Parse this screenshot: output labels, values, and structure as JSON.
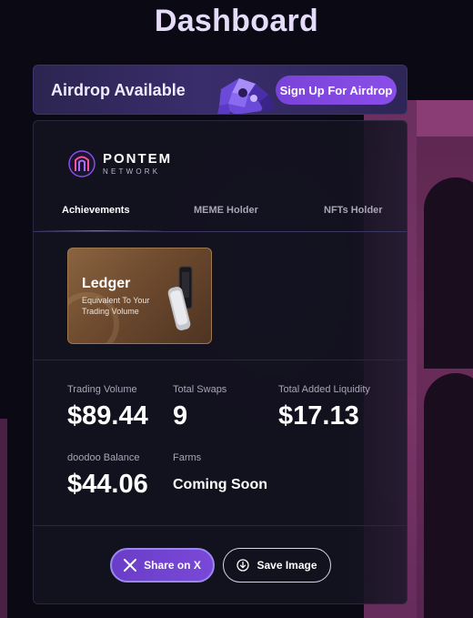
{
  "page": {
    "title": "Dashboard"
  },
  "airdrop": {
    "label": "Airdrop Available",
    "button_label": "Sign Up For Airdrop"
  },
  "brand": {
    "name": "PONTEM",
    "sub": "NETWORK"
  },
  "tabs": [
    {
      "label": "Achievements",
      "active": true
    },
    {
      "label": "MEME Holder",
      "active": false
    },
    {
      "label": "NFTs Holder",
      "active": false
    }
  ],
  "badge": {
    "title": "Ledger",
    "description": "Equivalent To Your Trading Volume"
  },
  "stats": {
    "trading_volume": {
      "label": "Trading Volume",
      "value": "$89.44"
    },
    "total_swaps": {
      "label": "Total Swaps",
      "value": "9"
    },
    "total_added_liquidity": {
      "label": "Total Added Liquidity",
      "value": "$17.13"
    },
    "doodoo_balance": {
      "label": "doodoo Balance",
      "value": "$44.06"
    },
    "farms": {
      "label": "Farms",
      "value": "Coming Soon"
    }
  },
  "actions": {
    "share_label": "Share on X",
    "save_label": "Save Image"
  },
  "icons": {
    "share": "x-logo-icon",
    "save": "download-icon",
    "brand": "pontem-logo-icon"
  },
  "colors": {
    "accent": "#7a48d8",
    "background": "#0a0914",
    "card": "#14121f"
  }
}
